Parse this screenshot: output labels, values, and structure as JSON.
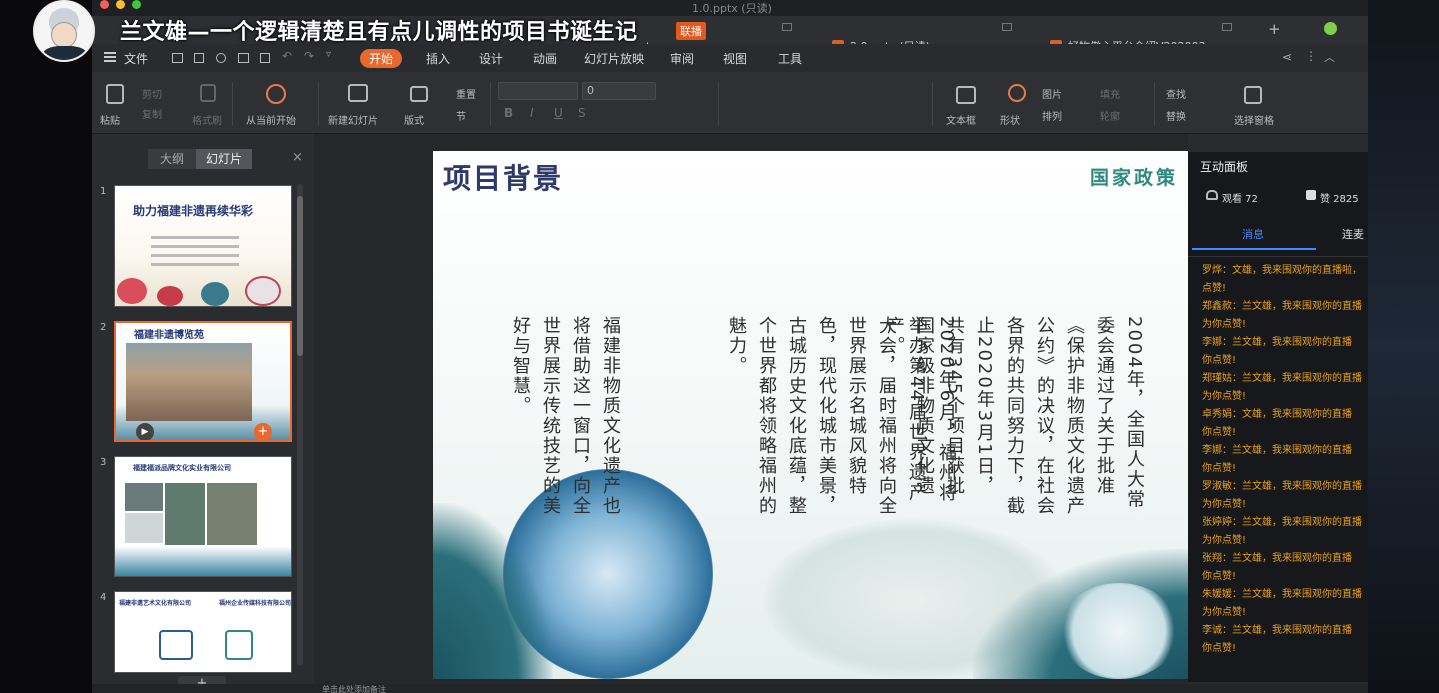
{
  "overlay": {
    "title": "兰文雄—一个逻辑清楚且有点儿调性的项目书诞生记",
    "live_badge": "联播"
  },
  "window": {
    "title": "1.0.pptx (只读)",
    "tabs": [
      {
        "label": "pptx"
      },
      {
        "label": "2.0.pptx (只读)"
      },
      {
        "label": "好物傲心平台介绍V202003"
      }
    ],
    "add_tab": "+"
  },
  "menu": {
    "file": "文件",
    "items": [
      "开始",
      "插入",
      "设计",
      "动画",
      "幻灯片放映",
      "审阅",
      "视图",
      "工具"
    ]
  },
  "ribbon": {
    "paste": "粘贴",
    "cut": "剪切",
    "copy": "复制",
    "format_painter": "格式刷",
    "from_current": "从当前开始",
    "new_slide": "新建幻灯片",
    "layout": "版式",
    "reset": "重置",
    "section": "节",
    "font_size": "0",
    "textbox": "文本框",
    "shape": "形状",
    "picture": "图片",
    "arrange": "排列",
    "fill": "填充",
    "outline": "轮廓",
    "find": "查找",
    "replace": "替换",
    "selection_pane": "选择窗格"
  },
  "panel": {
    "tab_outline": "大纲",
    "tab_slides": "幻灯片",
    "add_button": "+",
    "slides": [
      {
        "num": "1",
        "title": "助力福建非遗再续华彩"
      },
      {
        "num": "2",
        "title": "福建非遗博览苑"
      },
      {
        "num": "3",
        "title": "福建福派品牌文化实业有限公司"
      },
      {
        "num": "4",
        "title": "福建非遗艺术文化有限公司",
        "title2": "福州企业传媒科技有限公司"
      }
    ]
  },
  "slide": {
    "title": "项目背景",
    "tag": "国家政策",
    "paragraph1": "2004年，全国人大常委会通过了关于批准《保护非物质文化遗产公约》的决议，在社会各界的共同努力下，截止2020年3月1日，共有345个项目获批国家级非物质文化遗产。",
    "paragraph2": "2020年6月，福州将举办第44届世界遗产大会，届时福州将向全世界展示名城风貌特色，现代化城市美景，古城历史文化底蕴，整个世界都将领略福州的魅力。",
    "paragraph3": "福建非物质文化遗产也将借助这一窗口，向全世界展示传统技艺的美好与智慧。"
  },
  "status": {
    "notes_hint": "单击此处添加备注"
  },
  "chat": {
    "panel_title": "互动面板",
    "viewers": "观看 72",
    "likes": "赞 2825",
    "tab_messages": "消息",
    "tab_connect": "连麦",
    "messages": [
      {
        "line1": "罗烨：文雄，我来围观你的直播啦，",
        "line2": "点赞!"
      },
      {
        "line1": "郑鑫款：兰文雄，我来围观你的直播",
        "line2": "为你点赞!"
      },
      {
        "line1": "李娜：兰文雄，我来围观你的直播",
        "line2": "你点赞!"
      },
      {
        "line1": "郑瑾姑：兰文雄，我来围观你的直播",
        "line2": "为你点赞!"
      },
      {
        "line1": "卓秀娟：文雄，我来围观你的直播",
        "line2": "你点赞!"
      },
      {
        "line1": "李娜：兰文雄，我来围观你的直播",
        "line2": "你点赞!"
      },
      {
        "line1": "罗淑敏：兰文雄，我来围观你的直播",
        "line2": "为你点赞!"
      },
      {
        "line1": "张婷婷：兰文雄，我来围观你的直播",
        "line2": "为你点赞!"
      },
      {
        "line1": "张翔：兰文雄，我来围观你的直播",
        "line2": "你点赞!"
      },
      {
        "line1": "朱媛媛：兰文雄，我来围观你的直播",
        "line2": "为你点赞!"
      },
      {
        "line1": "李诚：兰文雄，我来围观你的直播",
        "line2": "你点赞!"
      }
    ]
  },
  "colors": {
    "accent": "#e8682e",
    "chat_text": "#e8a11a",
    "chat_tab": "#3d8bff",
    "slide_title": "#2d3a6a",
    "slide_tag": "#2e8a7d"
  }
}
